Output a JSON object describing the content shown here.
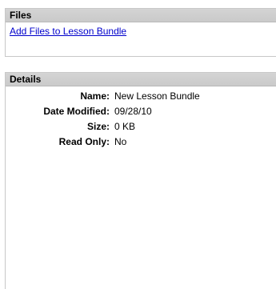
{
  "files_panel": {
    "title": "Files",
    "add_files_link": "Add Files to Lesson Bundle"
  },
  "details_panel": {
    "title": "Details",
    "rows": [
      {
        "label": "Name:",
        "value": "New Lesson Bundle"
      },
      {
        "label": "Date Modified:",
        "value": "09/28/10"
      },
      {
        "label": "Size:",
        "value": "0 KB"
      },
      {
        "label": "Read Only:",
        "value": "No"
      }
    ]
  },
  "colors": {
    "header_bg": "#cfcfcf",
    "link": "#0000cc",
    "border": "#c8c8c8"
  }
}
